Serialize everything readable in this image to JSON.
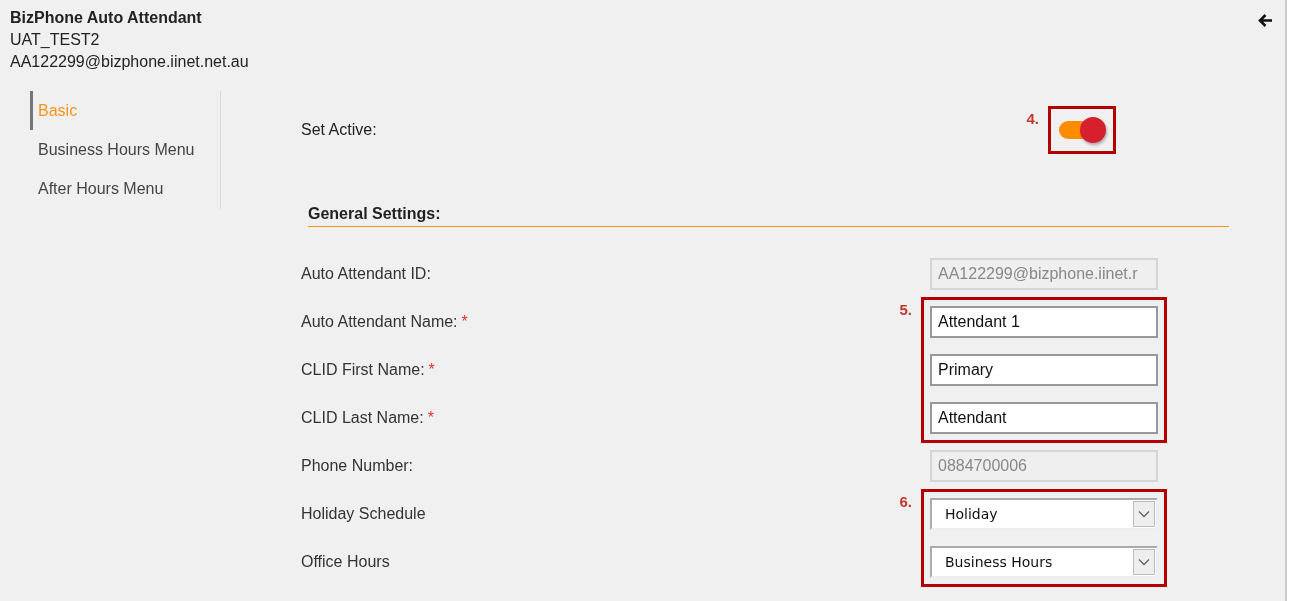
{
  "header": {
    "title": "BizPhone Auto Attendant",
    "subtitle": "UAT_TEST2",
    "address": "AA122299@bizphone.iinet.net.au"
  },
  "sidebar": {
    "items": [
      {
        "label": "Basic",
        "selected": true
      },
      {
        "label": "Business Hours Menu",
        "selected": false
      },
      {
        "label": "After Hours Menu",
        "selected": false
      }
    ]
  },
  "set_active": {
    "label": "Set Active:",
    "on": true,
    "callout": "4."
  },
  "section_title": "General Settings:",
  "field_groups": [
    {
      "fields": [
        {
          "kind": "readonly",
          "label": "Auto Attendant ID:",
          "value": "AA122299@bizphone.iinet.r"
        }
      ]
    },
    {
      "callout": "5.",
      "fields": [
        {
          "kind": "text",
          "label": "Auto Attendant Name:",
          "required_mark": "*",
          "value": "Attendant 1"
        },
        {
          "kind": "text",
          "label": "CLID First Name:",
          "required_mark": "*",
          "value": "Primary"
        },
        {
          "kind": "text",
          "label": "CLID Last Name:",
          "required_mark": "*",
          "value": "Attendant"
        }
      ]
    },
    {
      "fields": [
        {
          "kind": "readonly",
          "label": "Phone Number:",
          "value": "0884700006"
        }
      ]
    },
    {
      "callout": "6.",
      "fields": [
        {
          "kind": "select",
          "label": "Holiday Schedule",
          "value": "Holiday"
        },
        {
          "kind": "select",
          "label": "Office Hours",
          "value": "Business Hours"
        }
      ]
    }
  ]
}
